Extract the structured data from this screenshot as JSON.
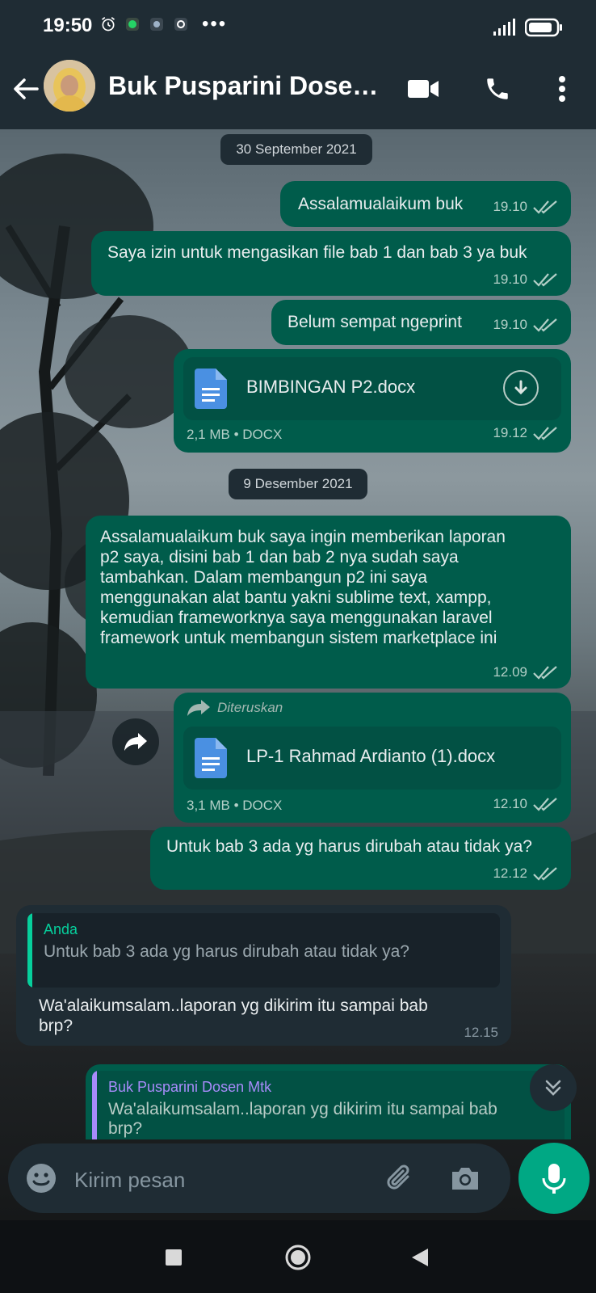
{
  "status_bar": {
    "time": "19:50",
    "icons": [
      "alarm-icon",
      "whatsapp-notif-icon",
      "app-notif-icon",
      "app-notif-icon",
      "more-notif-icon"
    ],
    "signal_icon": "signal-icon",
    "battery_icon": "battery-icon"
  },
  "header": {
    "contact_name": "Buk Pusparini Dosen Mtk",
    "back_icon": "arrow-left-icon",
    "video_icon": "video-call-icon",
    "call_icon": "phone-icon",
    "menu_icon": "more-vertical-icon"
  },
  "dates": {
    "first": "30 September 2021",
    "second": "9 Desember 2021"
  },
  "messages": {
    "m1": {
      "text": "Assalamualaikum buk",
      "time": "19.10"
    },
    "m2": {
      "text": "Saya izin untuk mengasikan file bab 1 dan bab 3 ya buk",
      "time": "19.10"
    },
    "m3": {
      "text": "Belum sempat ngeprint",
      "time": "19.10"
    },
    "m4": {
      "file_name": "BIMBINGAN P2.docx",
      "info": "2,1 MB • DOCX",
      "time": "19.12"
    },
    "m5": {
      "lines": [
        "Assalamualaikum buk saya ingin memberikan laporan",
        "p2 saya, disini bab 1 dan bab 2 nya sudah saya",
        "tambahkan. Dalam membangun p2 ini saya",
        "menggunakan alat bantu yakni sublime text, xampp,",
        "kemudian frameworknya saya menggunakan laravel",
        "framework untuk membangun sistem marketplace ini"
      ],
      "time": "12.09"
    },
    "m6": {
      "forwarded_label": "Diteruskan",
      "file_name": "LP-1 Rahmad Ardianto (1).docx",
      "info": "3,1 MB • DOCX",
      "time": "12.10"
    },
    "m7": {
      "text": "Untuk bab 3 ada yg harus dirubah atau tidak ya?",
      "time": "12.12"
    },
    "m8": {
      "quote_author": "Anda",
      "quote_text": "Untuk bab 3 ada yg harus dirubah atau tidak ya?",
      "lines": [
        "Wa'alaikumsalam..laporan yg dikirim itu sampai bab",
        "brp?"
      ],
      "time": "12.15"
    },
    "m9": {
      "quote_author": "Buk Pusparini Dosen Mtk",
      "quote_lines": [
        "Wa'alaikumsalam..laporan yg dikirim itu sampai bab",
        "brp?"
      ]
    }
  },
  "composer": {
    "placeholder": "Kirim pesan",
    "emoji_icon": "emoji-icon",
    "attach_icon": "paperclip-icon",
    "camera_icon": "camera-icon",
    "mic_icon": "mic-icon"
  },
  "colors": {
    "outgoing_bubble": "#005c4b",
    "incoming_bubble": "#1f2c34",
    "accent": "#00a884",
    "quote_self": "#06cf9c",
    "quote_contact": "#a78bfa"
  },
  "nav_bar": {
    "recents_icon": "square-icon",
    "home_icon": "circle-icon",
    "back_icon": "triangle-back-icon"
  }
}
